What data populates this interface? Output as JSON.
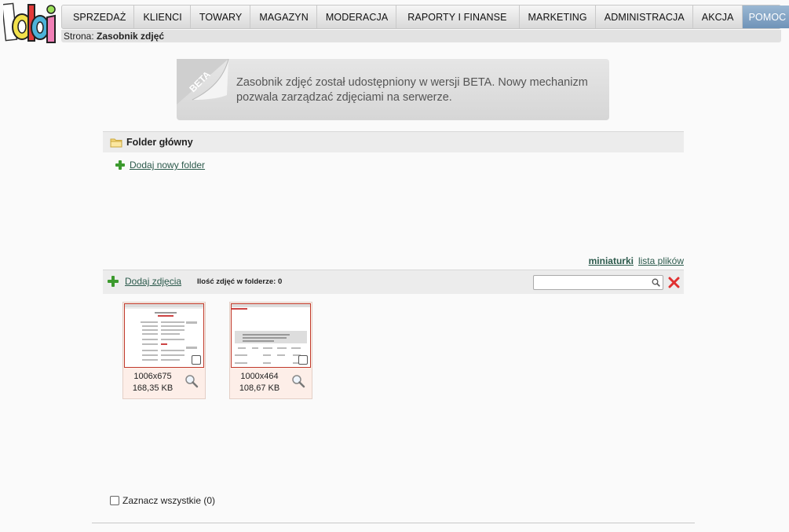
{
  "nav": {
    "items": [
      "SPRZEDAŻ",
      "KLIENCI",
      "TOWARY",
      "MAGAZYN",
      "MODERACJA",
      "RAPORTY I FINANSE",
      "MARKETING",
      "ADMINISTRACJA",
      "AKCJA"
    ],
    "help_label": "POMOC",
    "help_glyph": "?"
  },
  "breadcrumb": {
    "prefix": "Strona:",
    "current": "Zasobnik zdjęć"
  },
  "beta": {
    "badge": "BETA",
    "message": "Zasobnik zdjęć został udostępniony w wersji BETA. Nowy mechanizm pozwala zarządzać zdjęciami na serwerze."
  },
  "folder": {
    "title": "Folder główny",
    "add_label": "Dodaj nowy folder"
  },
  "view_mode": {
    "thumbnails": "miniaturki",
    "list": "lista plików"
  },
  "photos": {
    "add_label": "Dodaj zdjęcia",
    "count_label": "Ilość zdjęć w folderze: 0",
    "search_placeholder": "",
    "items": [
      {
        "dims": "1006x675",
        "size": "168,35 KB"
      },
      {
        "dims": "1000x464",
        "size": "108,67 KB"
      }
    ]
  },
  "select_all": {
    "label": "Zaznacz wszystkie (0)"
  }
}
